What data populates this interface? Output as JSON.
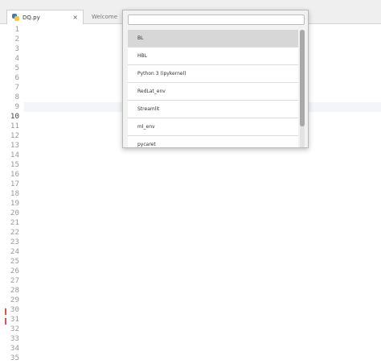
{
  "tabs": [
    {
      "label": "DQ.py",
      "close": "×"
    },
    {
      "label": "Welcome"
    }
  ],
  "kernel_popup": {
    "search_placeholder": "",
    "items": [
      "BL",
      "HBL",
      "Python 3 (ipykernel)",
      "RedLat_env",
      "Streamlit",
      "ml_env",
      "pycaret"
    ],
    "selected_index": 0
  },
  "editor": {
    "line_numbers": [
      "1",
      "2",
      "3",
      "4",
      "5",
      "6",
      "7",
      "8",
      "9",
      "10",
      "11",
      "12",
      "13",
      "14",
      "15",
      "16",
      "17",
      "18",
      "19",
      "20",
      "21",
      "22",
      "23",
      "24",
      "25",
      "26",
      "27",
      "28",
      "29",
      "30",
      "31",
      "32",
      "33",
      "34",
      "35"
    ],
    "current_line": 10
  }
}
